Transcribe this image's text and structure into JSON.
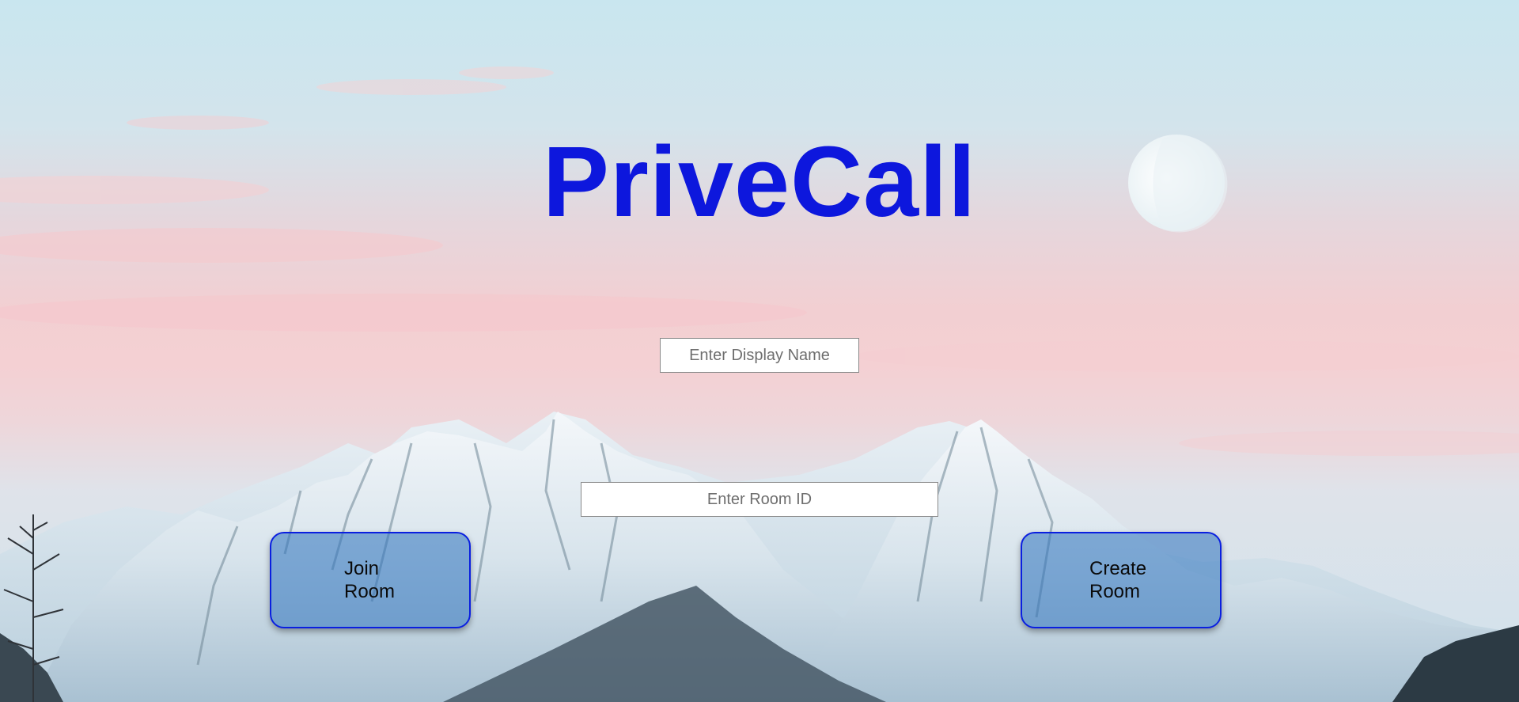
{
  "app": {
    "title": "PriveCall"
  },
  "form": {
    "display_name_placeholder": "Enter Display Name",
    "display_name_value": "",
    "room_id_placeholder": "Enter Room ID",
    "room_id_value": ""
  },
  "actions": {
    "join_label": "Join Room",
    "create_label": "Create Room"
  },
  "colors": {
    "title": "#0d17dd",
    "button_border": "#0a1fe0",
    "button_fill": "#2d73be"
  },
  "background": {
    "scene": "snowy mountain range under pastel pink and blue sky with crescent moon"
  }
}
